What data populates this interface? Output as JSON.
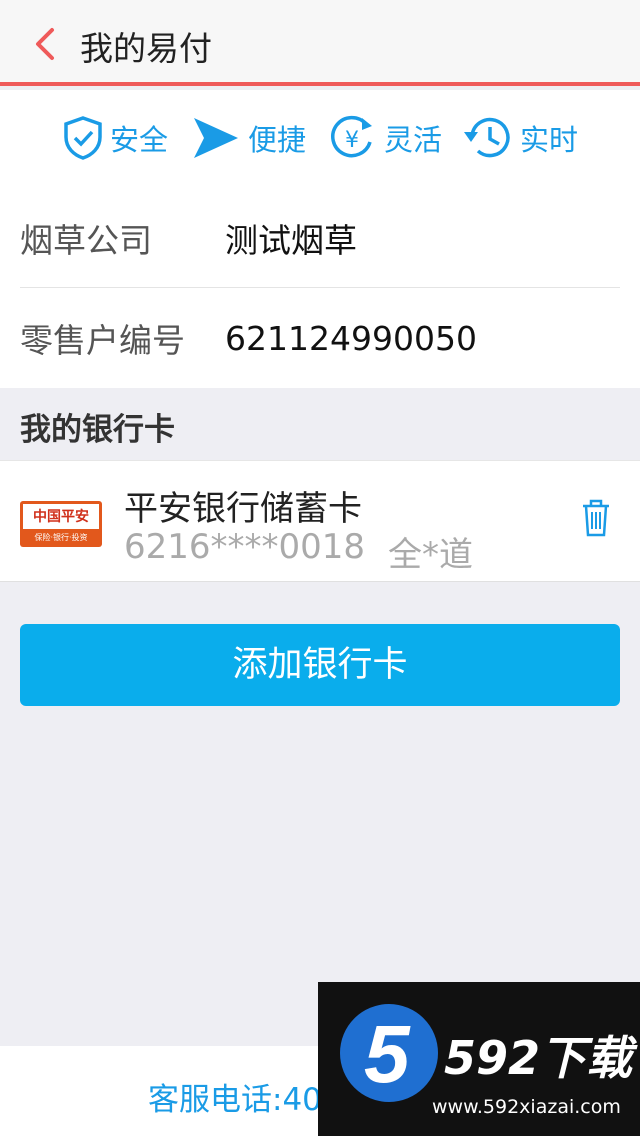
{
  "header": {
    "title": "我的易付",
    "back_icon": "chevron-left-icon"
  },
  "features": [
    {
      "label": "安全",
      "icon": "shield-check-icon"
    },
    {
      "label": "便捷",
      "icon": "paper-plane-icon"
    },
    {
      "label": "灵活",
      "icon": "yuan-cycle-icon"
    },
    {
      "label": "实时",
      "icon": "clock-history-icon"
    }
  ],
  "info": {
    "company_label": "烟草公司",
    "company_value": "测试烟草",
    "retailer_label": "零售户编号",
    "retailer_value": "621124990050"
  },
  "bank_section": {
    "title": "我的银行卡"
  },
  "card": {
    "logo_text": "中国平安",
    "logo_sub": "保险·银行·投资",
    "bank_name": "平安银行储蓄卡",
    "number": "6216****0018",
    "holder": "全*道"
  },
  "add_button": {
    "label": "添加银行卡"
  },
  "footer": {
    "service_text": "客服电话:40"
  },
  "watermark": {
    "digit": "5",
    "brand": "592下载",
    "url": "www.592xiazai.com"
  },
  "colors": {
    "accent_blue": "#1a9be6",
    "button_blue": "#0aadec",
    "header_line": "#ef5a5a"
  }
}
